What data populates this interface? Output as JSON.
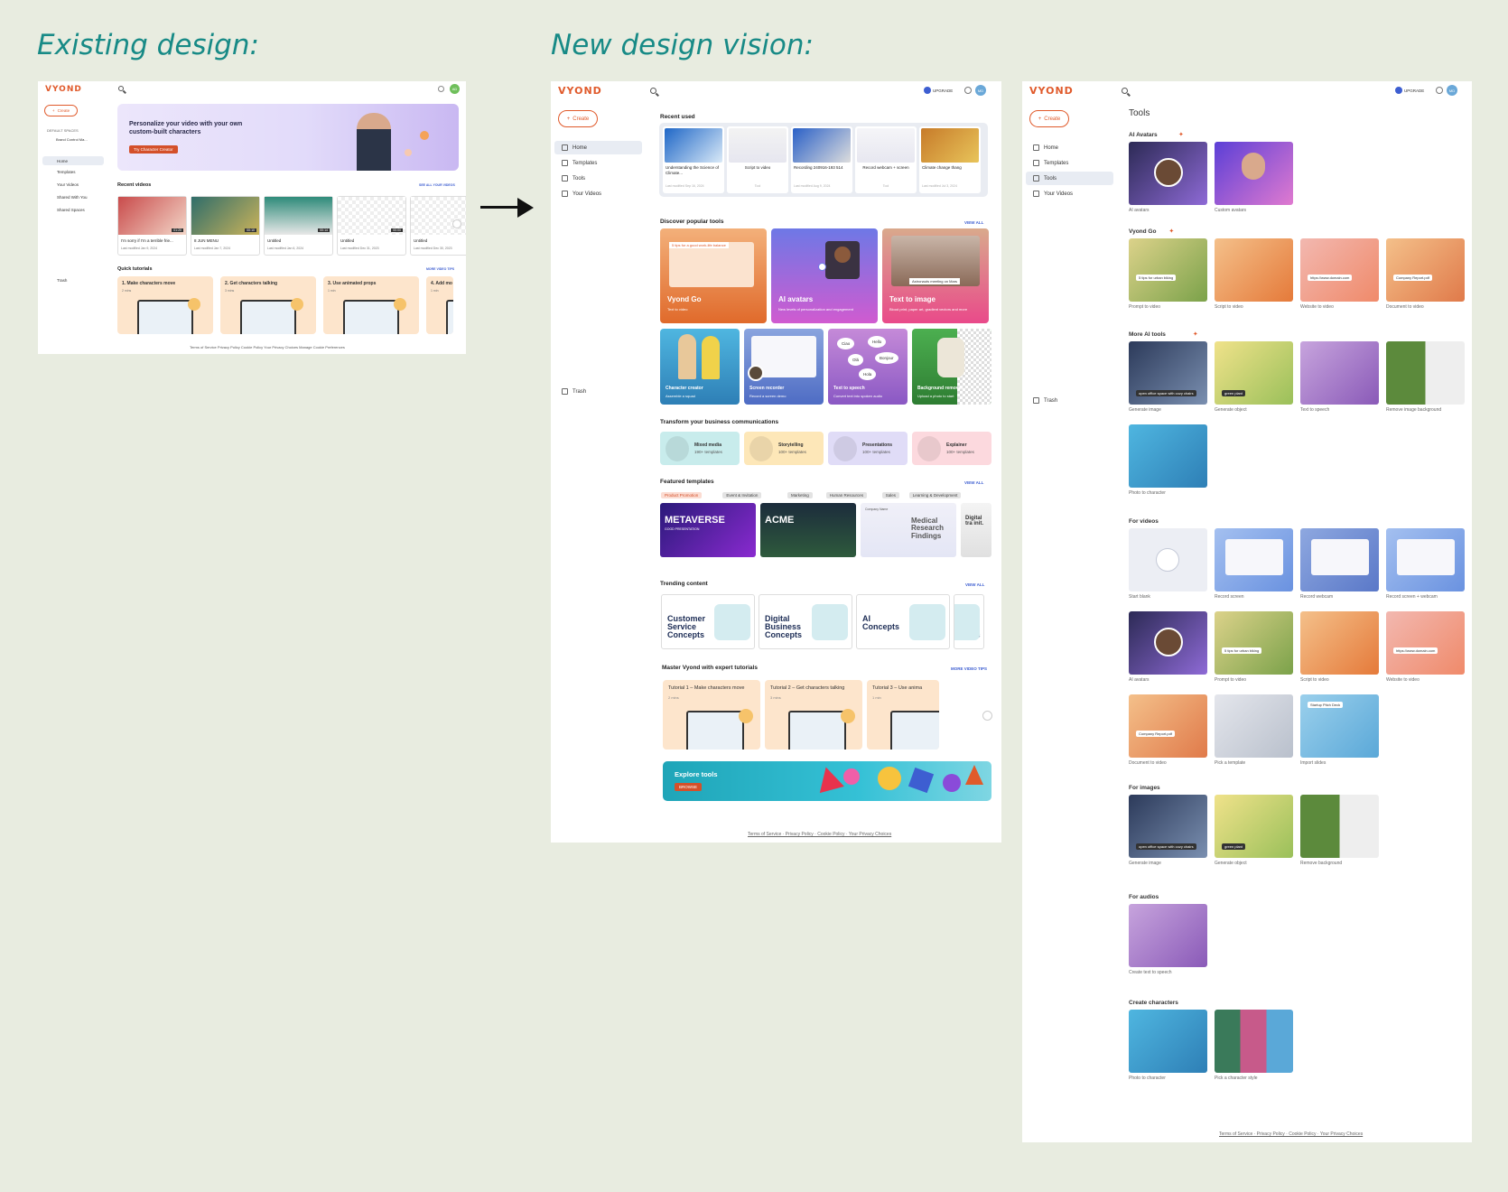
{
  "headings": {
    "existing": "Existing design:",
    "new": "New design vision:"
  },
  "brand": {
    "logo": "VYOND",
    "accent": "#e05a2b"
  },
  "old": {
    "create": "Create",
    "spaces_header": "DEFAULT SPACES",
    "space_item": "Brand Control Ma...",
    "nav": [
      "Home",
      "Templates",
      "Your Videos",
      "Shared With You",
      "Shared Spaces"
    ],
    "trash": "Trash",
    "avatar_initials": "AD",
    "banner_title": "Personalize your video with your own custom-built characters",
    "banner_btn": "Try Character Creator",
    "recent_title": "Recent videos",
    "recent_link": "SEE ALL YOUR VIDEOS",
    "videos": [
      {
        "title": "I'm sorry if I'm a terrible frie...",
        "date": "Last modified Jan 9, 2024",
        "dur": "01:20"
      },
      {
        "title": "8 JUN MENU",
        "date": "Last modified Jan 7, 2024",
        "dur": "00:10"
      },
      {
        "title": "Untitled",
        "date": "Last modified Jan 6, 2024",
        "dur": "00:14"
      },
      {
        "title": "Untitled",
        "date": "Last modified Dec 31, 2023",
        "dur": "00:00"
      },
      {
        "title": "Untitled",
        "date": "Last modified Dec 30, 2023",
        "dur": ""
      }
    ],
    "tutorials_title": "Quick tutorials",
    "tutorials_link": "MORE VIDEO TIPS",
    "tutorials": [
      {
        "title": "1. Make characters move",
        "meta": "2 mins"
      },
      {
        "title": "2. Get characters talking",
        "meta": "3 mins"
      },
      {
        "title": "3. Use animated props",
        "meta": "1 min"
      },
      {
        "title": "4. Add mo",
        "meta": "1 min"
      }
    ],
    "footer": "Terms of Service  Privacy Policy  Cookie Policy  Your Privacy Choices  Manage Cookie Preferences"
  },
  "home": {
    "create": "Create",
    "upgrade": "UPGRADE",
    "avatar_initials": "MD",
    "nav": [
      "Home",
      "Templates",
      "Tools",
      "Your Videos"
    ],
    "trash": "Trash",
    "recent_title": "Recent used",
    "recent": [
      {
        "title": "Understanding the Science of Climate...",
        "date": "Last modified Sep 16, 2024"
      },
      {
        "title": "Script to video",
        "date": "Tool"
      },
      {
        "title": "Recording 240916-193 514",
        "date": "Last modified Aug 9, 2024"
      },
      {
        "title": "Record webcam + screen",
        "date": "Tool"
      },
      {
        "title": "Climate change thang",
        "date": "Last modified Jul 3, 2024"
      }
    ],
    "popular_title": "Discover popular tools",
    "popular_link": "VIEW ALL",
    "popular_big": [
      {
        "title": "Vyond Go",
        "sub": "Text to video",
        "tag": "5 tips for a good work-life balance"
      },
      {
        "title": "AI avatars",
        "sub": "New levels of personalization and engagement"
      },
      {
        "title": "Text to image",
        "sub": "Blood print, paper art, gradient vectors and more",
        "tag": "Astronauts meeting on Mars"
      }
    ],
    "popular_small": [
      {
        "title": "Character creator",
        "sub": "Assemble a squad"
      },
      {
        "title": "Screen recorder",
        "sub": "Record a screen demo"
      },
      {
        "title": "Text to speech",
        "sub": "Convert text into spoken audio"
      },
      {
        "title": "Background remover",
        "sub": "Upload a photo to start"
      }
    ],
    "speech_words": [
      "Ciao",
      "Hello",
      "Olá",
      "Bonjour",
      "Hola"
    ],
    "biz_title": "Transform your business communications",
    "biz": [
      {
        "title": "Mixed media",
        "sub": "190+ templates"
      },
      {
        "title": "Storytelling",
        "sub": "100+ templates"
      },
      {
        "title": "Presentations",
        "sub": "100+ templates"
      },
      {
        "title": "Explainer",
        "sub": "100+ templates"
      }
    ],
    "featured_title": "Featured templates",
    "featured_link": "VIEW ALL",
    "chips": [
      "Product Promotion",
      "Event & Invitation",
      "Marketing",
      "Human Resources",
      "Sales",
      "Learning & Development"
    ],
    "featured": [
      "METAVERSE",
      "ACME",
      "Medical Research Findings",
      "Digital tra init."
    ],
    "featured_sub": [
      "GOOD PRESENTATION",
      "",
      "Company Name",
      ""
    ],
    "trending_title": "Trending content",
    "trending_link": "VIEW ALL",
    "trending": [
      "Customer Service Concepts",
      "Digital Business Concepts",
      "AI Concepts",
      "Da Acc Conc"
    ],
    "tut_title": "Master Vyond with expert tutorials",
    "tut_link": "MORE VIDEO TIPS",
    "tutorials": [
      {
        "title": "Tutorial 1 – Make characters move",
        "meta": "2 mins"
      },
      {
        "title": "Tutorial 2 – Get characters talking",
        "meta": "3 mins"
      },
      {
        "title": "Tutorial 3 – Use anima",
        "meta": "1 min"
      }
    ],
    "explore_title": "Explore tools",
    "explore_btn": "BROWSE",
    "footer": "Terms of Service · Privacy Policy · Cookie Policy · Your Privacy Choices"
  },
  "tools": {
    "create": "Create",
    "upgrade": "UPGRADE",
    "avatar_initials": "MD",
    "nav": [
      "Home",
      "Templates",
      "Tools",
      "Your Videos"
    ],
    "trash": "Trash",
    "page_title": "Tools",
    "sections": [
      {
        "title": "AI Avatars",
        "items": [
          "AI avatars",
          "Custom avatars"
        ]
      },
      {
        "title": "Vyond Go",
        "items": [
          "Prompt to video",
          "Script to video",
          "Website to video",
          "Document to video"
        ]
      },
      {
        "title": "More AI tools",
        "items": [
          "Generate image",
          "Generate object",
          "Text to speech",
          "Remove image background",
          "Photo to character"
        ]
      },
      {
        "title": "For videos",
        "items": [
          "Start blank",
          "Record screen",
          "Record webcam",
          "Record screen + webcam",
          "AI avatars",
          "Prompt to video",
          "Script to video",
          "Website to video",
          "Document to video",
          "Pick a template",
          "Import slides"
        ]
      },
      {
        "title": "For images",
        "items": [
          "Generate image",
          "Generate object",
          "Remove background"
        ]
      },
      {
        "title": "For audios",
        "items": [
          "Create text to speech"
        ]
      },
      {
        "title": "Create characters",
        "items": [
          "Photo to character",
          "Pick a character style"
        ]
      }
    ],
    "thumb_texts": {
      "bike": "5 tips for urban biking",
      "company": "Company Report.pdf",
      "website": "https://www.domain.com",
      "office": "open office space with cozy chairs",
      "plant": "green plant",
      "startup": "Startup Pitch Deck"
    },
    "footer": "Terms of Service · Privacy Policy · Cookie Policy · Your Privacy Choices"
  }
}
